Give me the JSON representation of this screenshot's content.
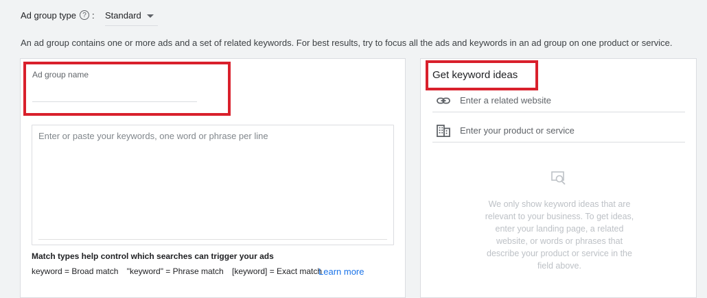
{
  "ad_group_type": {
    "label": "Ad group type",
    "help_icon": "?",
    "colon": ":",
    "selected": "Standard"
  },
  "description": "An ad group contains one or more ads and a set of related keywords. For best results, try to focus all the ads and keywords in an ad group on one product or service.",
  "left_panel": {
    "name_label": "Ad group name",
    "name_value": "",
    "keywords_placeholder": "Enter or paste your keywords, one word or phrase per line",
    "match_title": "Match types help control which searches can trigger your ads",
    "match_types": [
      "keyword = Broad match",
      "\"keyword\" = Phrase match",
      "[keyword] = Exact match"
    ],
    "learn_more": "Learn more"
  },
  "right_panel": {
    "title": "Get keyword ideas",
    "website_placeholder": "Enter a related website",
    "product_placeholder": "Enter your product or service",
    "empty_message": "We only show keyword ideas that are relevant to your business. To get ideas, enter your landing page, a related website, or words or phrases that describe your product or service in the field above."
  },
  "icons": {
    "help": "help-circle-icon",
    "dropdown": "caret-down-icon",
    "website": "link-icon",
    "product": "building-icon",
    "empty": "search-document-icon"
  },
  "colors": {
    "highlight": "#d9202c",
    "link": "#1a73e8",
    "background": "#f1f3f4"
  }
}
